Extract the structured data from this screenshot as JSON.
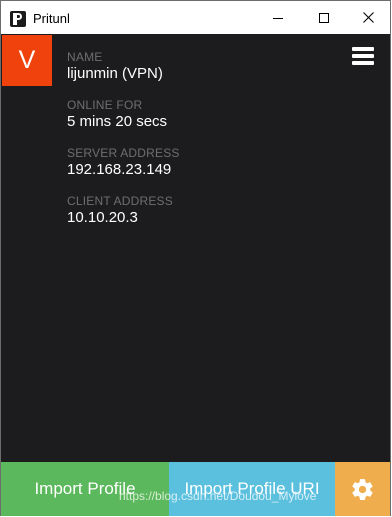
{
  "window": {
    "title": "Pritunl",
    "app_icon": "pritunl-logo-icon"
  },
  "profile": {
    "badge_letter": "V",
    "badge_color": "#f0420c",
    "fields": [
      {
        "label": "NAME",
        "value": "lijunmin (VPN)"
      },
      {
        "label": "ONLINE FOR",
        "value": "5 mins 20 secs"
      },
      {
        "label": "SERVER ADDRESS",
        "value": "192.168.23.149"
      },
      {
        "label": "CLIENT ADDRESS",
        "value": "10.10.20.3"
      }
    ]
  },
  "menu": {
    "icon": "hamburger-menu-icon"
  },
  "buttons": {
    "import_profile": "Import Profile",
    "import_profile_uri": "Import Profile URI",
    "settings_icon": "gear-icon",
    "colors": {
      "import_profile": "#5cb85c",
      "import_profile_uri": "#5bc0de",
      "settings": "#f0ad4e"
    }
  },
  "watermark": "https://blog.csdn.net/Doudou_Mylove"
}
